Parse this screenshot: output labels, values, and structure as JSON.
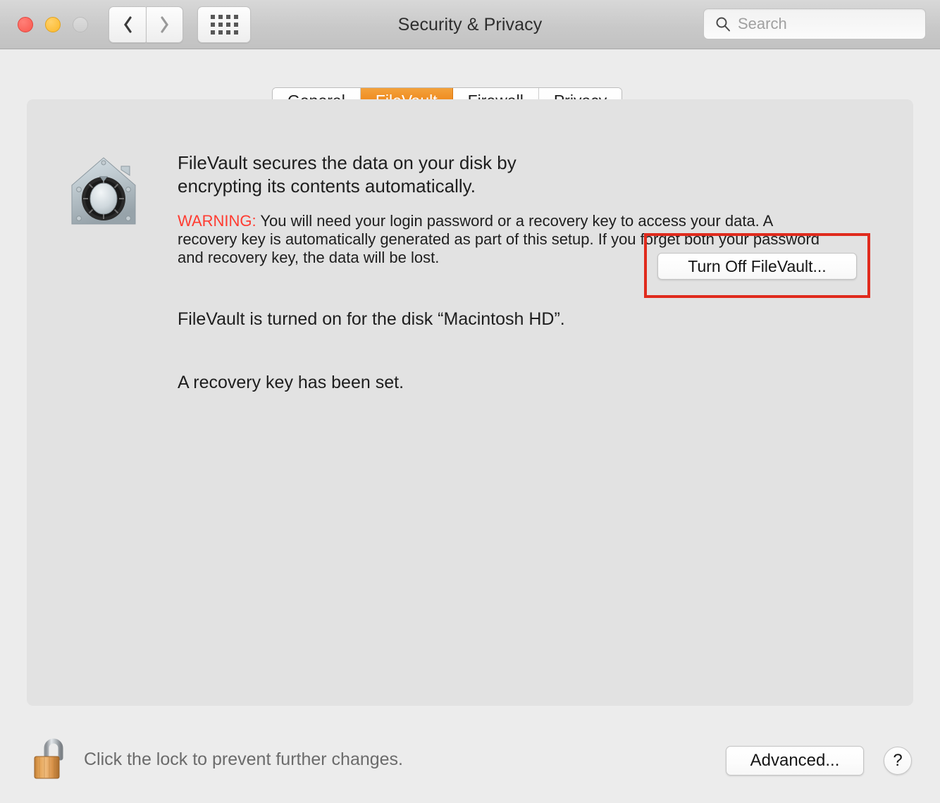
{
  "titlebar": {
    "title": "Security & Privacy",
    "traffic": {
      "close": "close-button",
      "minimize": "minimize-button",
      "zoom": "zoom-button"
    },
    "nav": {
      "back": "back-button",
      "forward": "forward-button",
      "grid": "show-all-button"
    },
    "search": {
      "placeholder": "Search",
      "value": "",
      "icon": "search-icon"
    }
  },
  "tabs": [
    {
      "label": "General",
      "active": false
    },
    {
      "label": "FileVault",
      "active": true
    },
    {
      "label": "Firewall",
      "active": false
    },
    {
      "label": "Privacy",
      "active": false
    }
  ],
  "main": {
    "icon_name": "filevault-house-safe-icon",
    "description": "FileVault secures the data on your disk by encrypting its contents automatically.",
    "warning_label": "WARNING:",
    "warning_body": " You will need your login password or a recovery key to access your data. A recovery key is automatically generated as part of this setup. If you forget both your password and recovery key, the data will be lost.",
    "status_disk": "FileVault is turned on for the disk “Macintosh HD”.",
    "status_key": "A recovery key has been set.",
    "turn_off_button": "Turn Off FileVault...",
    "highlight_color": "#e02b1d"
  },
  "footer": {
    "lock_icon": "unlocked-padlock-icon",
    "lock_text": "Click the lock to prevent further changes.",
    "advanced_button": "Advanced...",
    "help_button": "?"
  },
  "colors": {
    "accent_orange": "#ee8a1e",
    "warning_red": "#ff3b30",
    "panel_bg": "#e2e2e2",
    "window_bg": "#ececec",
    "titlebar_bg": "#cccccc"
  }
}
